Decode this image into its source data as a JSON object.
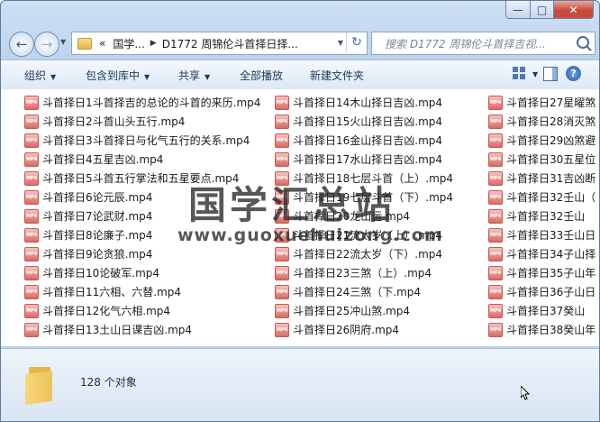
{
  "window": {
    "controls": {
      "minimize": "—",
      "maximize": "□",
      "close": "✕"
    }
  },
  "navigation": {
    "back_icon": "back-arrow-icon",
    "forward_icon": "forward-arrow-icon",
    "address": {
      "overflow": "«",
      "crumbs": [
        "国学...",
        "D1772 周锦伦斗首择日择..."
      ]
    },
    "search_placeholder": "搜索 D1772 周锦伦斗首择吉视..."
  },
  "toolbar": {
    "organize": "组织",
    "include_in_library": "包含到库中",
    "share": "共享",
    "play_all": "全部播放",
    "new_folder": "新建文件夹"
  },
  "files": {
    "icon_label": "MP4",
    "columns": [
      [
        "斗首择日1斗首择吉的总论的斗首的来历.mp4",
        "斗首择日2斗首山头五行.mp4",
        "斗首择日3斗首择日与化气五行的关系.mp4",
        "斗首择日4五星吉凶.mp4",
        "斗首择日5斗首五行掌法和五星要点.mp4",
        "斗首择日6论元辰.mp4",
        "斗首择日7论武财.mp4",
        "斗首择日8论廉子.mp4",
        "斗首择日9论贪狼.mp4",
        "斗首择日10论破军.mp4",
        "斗首择日11六相、六替.mp4",
        "斗首择日12化气六相.mp4",
        "斗首择日13土山日课吉凶.mp4"
      ],
      [
        "斗首择日14木山择日吉凶.mp4",
        "斗首择日15火山择日吉凶.mp4",
        "斗首择日16金山择日吉凶.mp4",
        "斗首择日17水山择日吉凶.mp4",
        "斗首择日18七层斗首（上）.mp4",
        "斗首择日19七层斗首（下）.mp4",
        "斗首择日20龙山运.mp4",
        "斗首择日21流太岁（上）.mp4",
        "斗首择日22流太岁（下）.mp4",
        "斗首择日23三煞（上）.mp4",
        "斗首择日24三煞（下.mp4",
        "斗首择日25冲山煞.mp4",
        "斗首择日26阴府.mp4"
      ],
      [
        "斗首择日27星曜煞",
        "斗首择日28消灭煞",
        "斗首择日29凶煞避",
        "斗首择日30五星位",
        "斗首择日31吉凶断",
        "斗首择日32壬山（",
        "斗首择日32壬山",
        "斗首择日33壬山日",
        "斗首择日34子山择",
        "斗首择日35子山年",
        "斗首择日36子山日",
        "斗首择日37癸山",
        "斗首择日38癸山年"
      ]
    ]
  },
  "watermark": {
    "title": "国学汇总站",
    "url": "www.guoxuehuizong.com"
  },
  "status": {
    "count_text": "128 个对象"
  }
}
